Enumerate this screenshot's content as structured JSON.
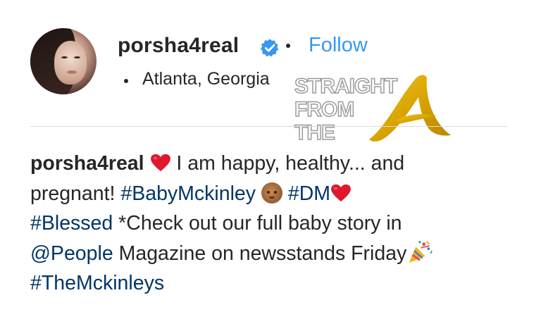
{
  "post_header": {
    "username": "porsha4real",
    "follow_label": "Follow",
    "location": "Atlanta, Georgia"
  },
  "watermark": {
    "lines": [
      "STRAIGHT",
      "FROM",
      "THE"
    ],
    "letter": "A"
  },
  "caption": {
    "username": "porsha4real",
    "line1_text": " I am happy, healthy... and",
    "line2_text_a": "pregnant! ",
    "line2_tag1": "#BabyMckinley",
    "line2_tag2": "#DM",
    "line3_tag": "#Blessed",
    "line3_text": " *Check out our full baby story in",
    "line4_mention": "@People",
    "line4_text": " Magazine on newsstands Friday",
    "line5_tag": "#TheMckinleys"
  },
  "colors": {
    "link": "#3897f0",
    "hashtag": "#003569",
    "text": "#262626",
    "divider": "#dbdbdb",
    "heart": "#e0182d",
    "watermark_gold": "#d9a400"
  },
  "icons": [
    "verified-badge-icon",
    "heart-emoji-icon",
    "baby-emoji-icon",
    "party-popper-emoji-icon"
  ]
}
